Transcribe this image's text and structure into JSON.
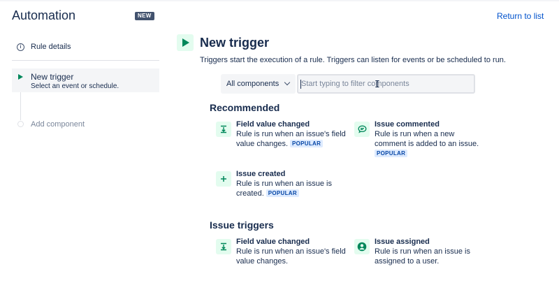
{
  "header": {
    "title": "Automation",
    "badge": "NEW",
    "return_link": "Return to list"
  },
  "sidebar": {
    "rule_details": "Rule details",
    "new_trigger": {
      "title": "New trigger",
      "subtitle": "Select an event or schedule."
    },
    "add_component": "Add component"
  },
  "main": {
    "title": "New trigger",
    "description": "Triggers start the execution of a rule. Triggers can listen for events or be scheduled to run.",
    "filter": {
      "selected": "All components",
      "placeholder": "Start typing to filter components",
      "value": ""
    },
    "sections": [
      {
        "title": "Recommended",
        "items": [
          {
            "icon": "field-value-icon",
            "title": "Field value changed",
            "description": "Rule is run when an issue's field value changes.",
            "badge": "POPULAR"
          },
          {
            "icon": "comment-icon",
            "title": "Issue commented",
            "description": "Rule is run when a new comment is added to an issue.",
            "badge": "POPULAR"
          },
          {
            "icon": "plus-icon",
            "title": "Issue created",
            "description": "Rule is run when an issue is created.",
            "badge": "POPULAR"
          }
        ]
      },
      {
        "title": "Issue triggers",
        "items": [
          {
            "icon": "field-value-icon",
            "title": "Field value changed",
            "description": "Rule is run when an issue's field value changes."
          },
          {
            "icon": "user-icon",
            "title": "Issue assigned",
            "description": "Rule is run when an issue is assigned to a user."
          }
        ]
      }
    ]
  },
  "colors": {
    "accent": "#0052cc",
    "trigger_green": "#00875a",
    "icon_bg": "#e3fcef",
    "badge_bg": "#deebff",
    "text": "#172b4d"
  }
}
